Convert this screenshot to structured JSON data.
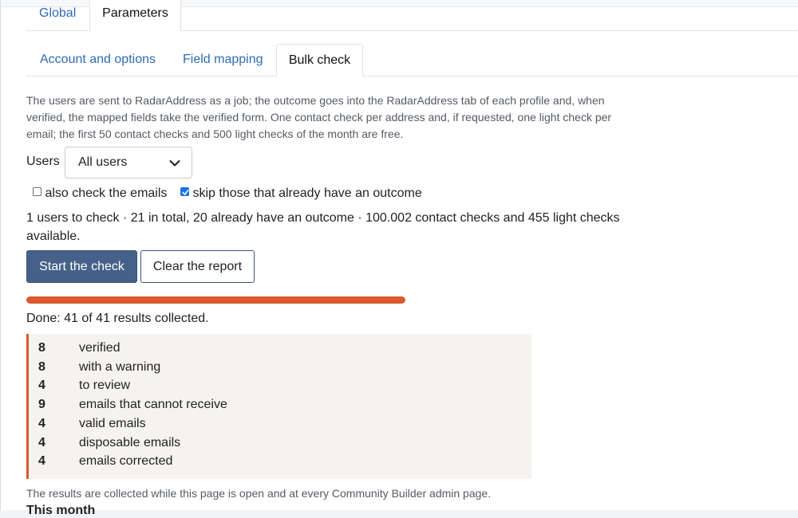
{
  "top_tabs": [
    {
      "label": "Global",
      "active": false
    },
    {
      "label": "Parameters",
      "active": true
    }
  ],
  "sub_tabs": [
    {
      "label": "Account and options",
      "active": false
    },
    {
      "label": "Field mapping",
      "active": false
    },
    {
      "label": "Bulk check",
      "active": true
    }
  ],
  "description": "The users are sent to RadarAddress as a job; the outcome goes into the RadarAddress tab of each profile and, when verified, the mapped fields take the verified form. One contact check per address and, if requested, one light check per email; the first 50 contact checks and 500 light checks of the month are free.",
  "users": {
    "label": "Users",
    "selected": "All users"
  },
  "options": {
    "check_emails": {
      "label": "also check the emails",
      "checked": false
    },
    "skip_existing": {
      "label": "skip those that already have an outcome",
      "checked": true
    }
  },
  "summary": "1 users to check · 21 in total, 20 already have an outcome · 100.002 contact checks and 455 light checks available.",
  "buttons": {
    "start": "Start the check",
    "clear": "Clear the report"
  },
  "progress": {
    "fraction": 1.0,
    "color": "#d9592d"
  },
  "status": "Done: 41 of 41 results collected.",
  "report": [
    {
      "count": "8",
      "label": "verified"
    },
    {
      "count": "8",
      "label": "with a warning"
    },
    {
      "count": "4",
      "label": "to review"
    },
    {
      "count": "9",
      "label": "emails that cannot receive"
    },
    {
      "count": "4",
      "label": "valid emails"
    },
    {
      "count": "4",
      "label": "disposable emails"
    },
    {
      "count": "4",
      "label": "emails corrected"
    }
  ],
  "footnote": "The results are collected while this page is open and at every Community Builder admin page.",
  "cut_heading": "This month"
}
